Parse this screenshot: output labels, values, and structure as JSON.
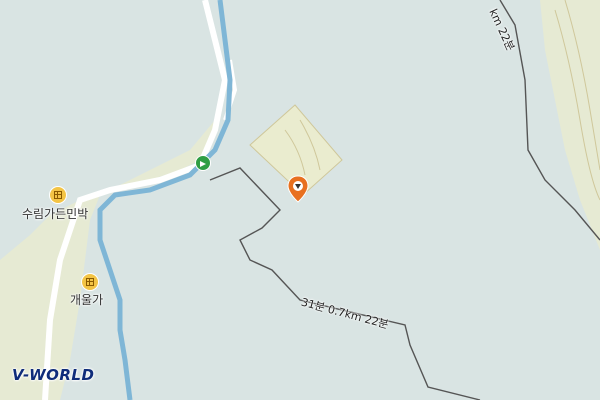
{
  "map": {
    "background_color": "#d9e4e3",
    "river_color": "#7fb6d6",
    "road_color": "#ffffff",
    "terrain_color": "#e8ecd6",
    "route_color": "#555555"
  },
  "pois": [
    {
      "name": "수림가든민박",
      "icon": "lodging-icon"
    },
    {
      "name": "개울가",
      "icon": "lodging-icon"
    }
  ],
  "route_labels": {
    "bottom": "31분 0.7km 22분",
    "top": "km 22분"
  },
  "marker": {
    "icon": "location-pin-icon",
    "color": "#e8701f"
  },
  "trail_marker": {
    "icon": "trail-arrow-icon",
    "color": "#2f9e44"
  },
  "brand": {
    "logo_text": "V-WORLD"
  }
}
